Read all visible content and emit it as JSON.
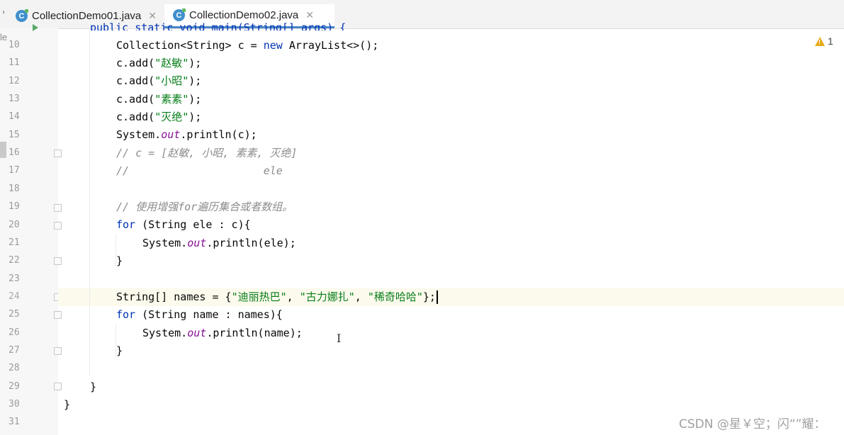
{
  "tabs": [
    {
      "label": "CollectionDemo01.java",
      "active": false,
      "icon": "class-icon"
    },
    {
      "label": "CollectionDemo02.java",
      "active": true,
      "icon": "class-icon"
    }
  ],
  "gutter_left_text": "le",
  "warning": {
    "count": "1",
    "icon": "warning-icon",
    "color": "#e5a91a"
  },
  "line_numbers": [
    "10",
    "11",
    "12",
    "13",
    "14",
    "15",
    "16",
    "17",
    "18",
    "19",
    "20",
    "21",
    "22",
    "23",
    "24",
    "25",
    "26",
    "27",
    "28",
    "29",
    "30",
    "31"
  ],
  "code": {
    "line_9": "public static void main(String[] args) {",
    "line_10_a": "Collection<String> c = ",
    "line_10_kw": "new",
    "line_10_b": " ArrayList<>();",
    "adds": [
      {
        "pre": "c.add(",
        "str": "\"赵敏\"",
        "post": ");"
      },
      {
        "pre": "c.add(",
        "str": "\"小昭\"",
        "post": ");"
      },
      {
        "pre": "c.add(",
        "str": "\"素素\"",
        "post": ");"
      },
      {
        "pre": "c.add(",
        "str": "\"灭绝\"",
        "post": ");"
      }
    ],
    "line_15": {
      "pre": "System.",
      "field": "out",
      "post": ".println(c);"
    },
    "line_16": "// c = [赵敏, 小昭, 素素, 灭绝]",
    "line_17": "//                     ele",
    "line_19": "// 使用增强for遍历集合或者数组。",
    "line_20": {
      "kw": "for",
      "post": " (String ele : c){"
    },
    "line_21": {
      "pre": "System.",
      "field": "out",
      "post": ".println(ele);"
    },
    "line_22": "}",
    "line_24": {
      "pre": "String[] names = {",
      "s1": "\"迪丽热巴\"",
      "sep1": ", ",
      "s2": "\"古力娜扎\"",
      "sep2": ", ",
      "s3": "\"稀奇哈哈\"",
      "post": "};"
    },
    "line_25": {
      "kw": "for",
      "post": " (String name : names){"
    },
    "line_26": {
      "pre": "System.",
      "field": "out",
      "post": ".println(name);"
    },
    "line_27": "}",
    "line_29": "}",
    "line_30": "}"
  },
  "watermark": "CSDN @星￥空；闪“”耀："
}
